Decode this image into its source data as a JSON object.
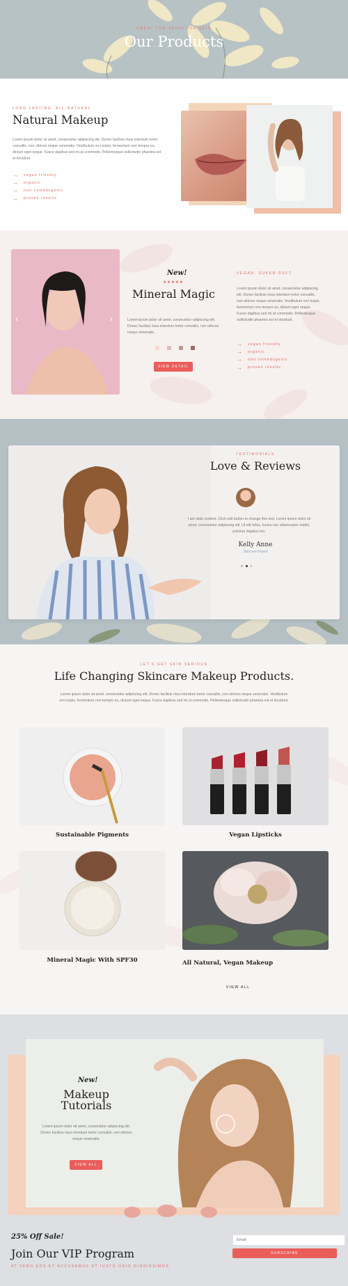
{
  "hero": {
    "kicker": "GREAT FOR SENSITIVE SKIN",
    "title": "Our Products"
  },
  "natural": {
    "kicker": "LONG LASTING, ALL-NATURAL",
    "title": "Natural Makeup",
    "body": "Lorem ipsum dolor sit amet, consectetur adipiscing elit. Donec facilisis risus interdum tortor convallis, non ultrices neque venenatis. Vestibulum orci turpis, fermentum non tempor eu, dictum eget neque. Fusce dapibus sed mi at commodo. Pellentesque sollicitudin pharetra est et tincidunt.",
    "features": [
      "vegan friendly",
      "organic",
      "non comedogenic",
      "proven results"
    ]
  },
  "mineral": {
    "badge": "New!",
    "stars": "★★★★★",
    "title": "Mineral Magic",
    "body": "Lorem ipsum dolor sit amet, consectetur adipiscing elit. Donec facilisis risus interdum tortor convallis, non ultrices neque venenatis.",
    "button": "VIEW DETAIL",
    "swatches": [
      "#f4d9d2",
      "#d9c1bb",
      "#b99891",
      "#9c6a64"
    ],
    "arrow_left": "‹",
    "arrow_right": "›",
    "right_kicker": "VEGAN, SUPER-SOFT",
    "right_body": "Lorem ipsum dolor sit amet, consectetur adipiscing elit. Donec facilisis risus interdum tortor convallis, non ultrices neque venenatis. Vestibulum orci turpis, fermentum non tempor eu, dictum eget neque. Fusce dapibus sed mi at commodo. Pellentesque sollicitudin pharetra est et tincidunt.",
    "features": [
      "vegan friendly",
      "organic",
      "non comedogenic",
      "proven results"
    ]
  },
  "reviews": {
    "kicker": "TESTIMONIALS",
    "title": "Love & Reviews",
    "quote": "I am slide content. Click edit button to change this text. Lorem ipsum dolor sit amet, consectetur adipiscing elit. Ut elit tellus, luctus nec ullamcorper mattis, pulvinar dapibus leo.",
    "name": "Kelly Anne",
    "role": "Skincare Expert"
  },
  "products": {
    "kicker": "LET'S GET SKIN SERIOUS",
    "title": "Life Changing Skincare Makeup Products.",
    "body": "Lorem ipsum dolor sit amet, consectetur adipiscing elit. Donec facilisis risus interdum tortor convallis, non ultrices neque venenatis. Vestibulum orci turpis, fermentum non tempor eu, dictum eget neque. Fusce dapibus sed mi at commodo. Pellentesque sollicitudin pharetra est et tincidunt.",
    "items": [
      "Sustainable Pigments",
      "Vegan Lipsticks",
      "Mineral Magic With SPF30",
      "All Natural, Vegan Makeup"
    ],
    "view_all": "VIEW ALL"
  },
  "tutorials": {
    "badge": "New!",
    "title_line1": "Makeup",
    "title_line2": "Tutorials",
    "body": "Lorem ipsum dolor sit amet, consectetur adipiscing elit. Donec facilisis risus interdum tortor convallis, non ultrices neque venenatis.",
    "button": "VIEW ALL"
  },
  "vip": {
    "badge": "25% Off Sale!",
    "title": "Join Our VIP Program",
    "kicker": "AT VERO EOS ET ACCUSAMUS ET IUSTO ODIO DIGNISSIMOS",
    "email_placeholder": "Email",
    "button": "SUBSCRIBE"
  },
  "colors": {
    "accent": "#ea5d5b",
    "blush": "#f1c6b3",
    "heroBg": "#b9c3c6"
  }
}
